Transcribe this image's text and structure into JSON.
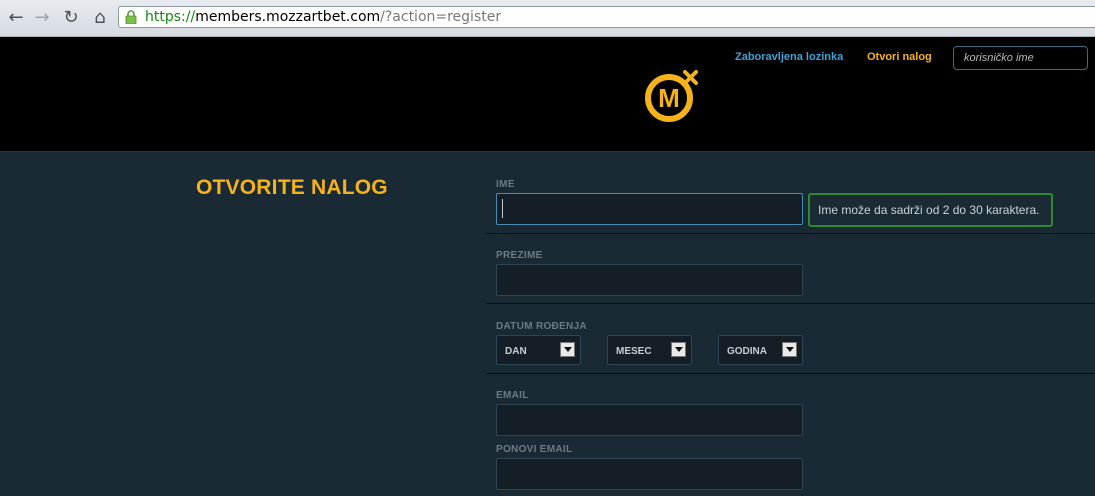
{
  "browser": {
    "url_scheme": "https://",
    "url_host": "members.mozzartbet.com",
    "url_path": "/?action=register"
  },
  "header": {
    "forgot_password": "Zaboravljena lozinka",
    "open_account": "Otvori nalog",
    "username_placeholder": "korisničko ime",
    "logo_letter": "M",
    "brand_color": "#f5b21b"
  },
  "form": {
    "title": "OTVORITE NALOG",
    "first_name": {
      "label": "IME",
      "value": "",
      "hint": "Ime može da sadrži od 2 do 30 karaktera."
    },
    "last_name": {
      "label": "PREZIME",
      "value": ""
    },
    "birth_date": {
      "label": "DATUM ROĐENJA",
      "day": "DAN",
      "month": "MESEC",
      "year": "GODINA"
    },
    "email": {
      "label": "EMAIL",
      "value": ""
    },
    "repeat_email": {
      "label": "PONOVI EMAIL",
      "value": ""
    }
  }
}
